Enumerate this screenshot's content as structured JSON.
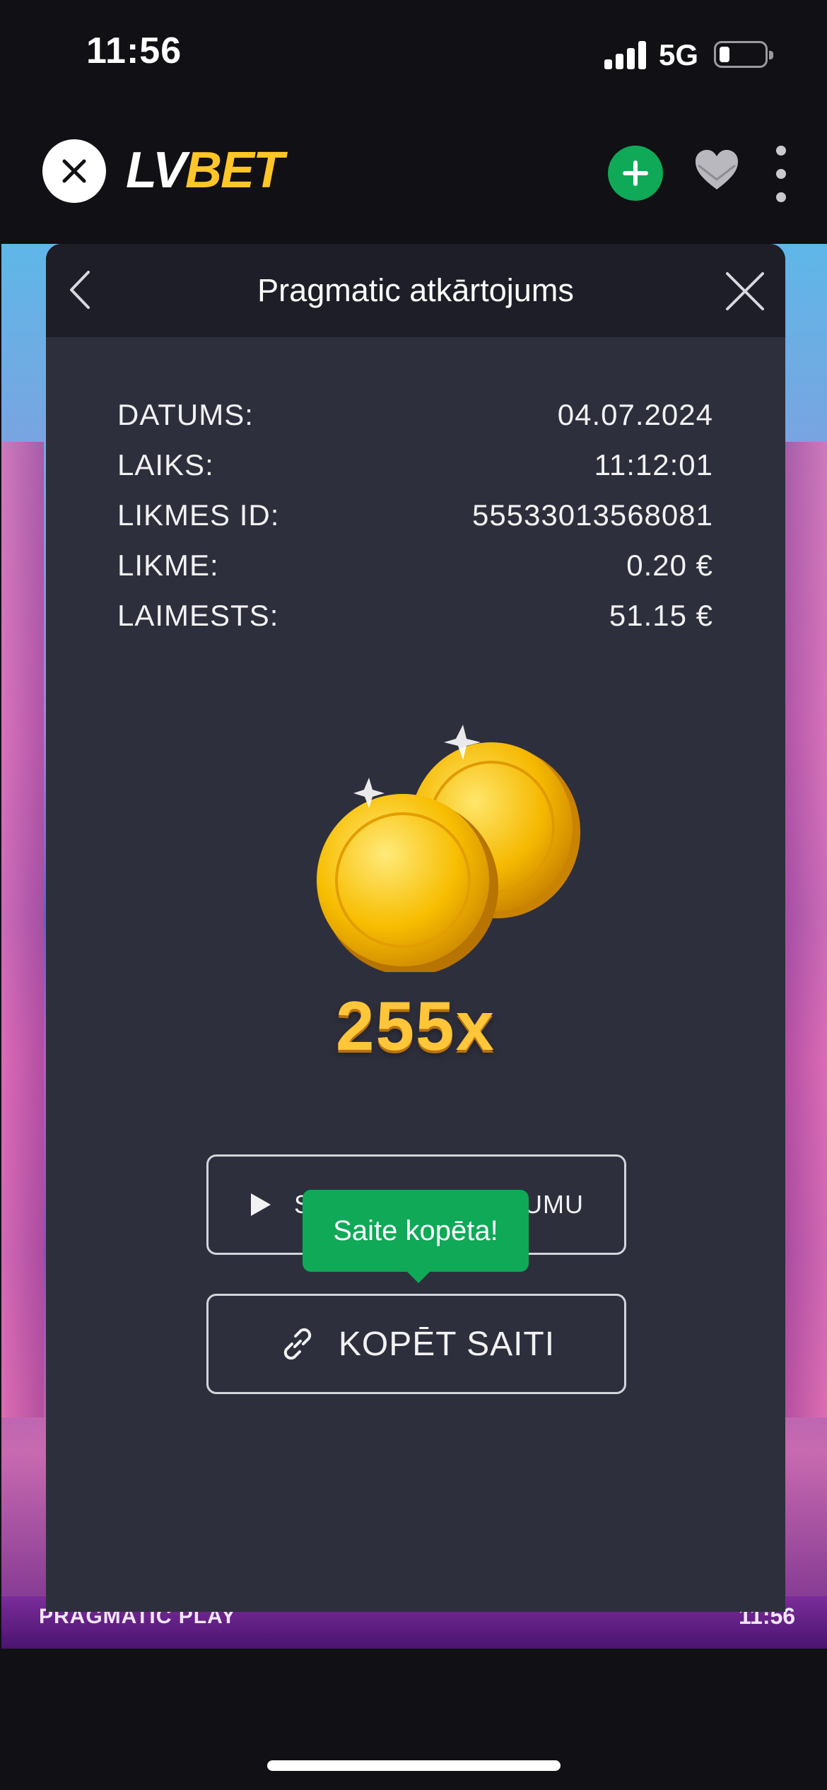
{
  "status_bar": {
    "time": "11:56",
    "network": "5G"
  },
  "app": {
    "brand_lv": "LV",
    "brand_bet": "BET",
    "brand_color": "#ffc629",
    "add_color": "#0fa958"
  },
  "game": {
    "provider": "PRAGMATIC PLAY",
    "clock": "11:56"
  },
  "modal": {
    "title": "Pragmatic atkārtojums",
    "rows": [
      {
        "label": "DATUMS:",
        "value": "04.07.2024"
      },
      {
        "label": "LAIKS:",
        "value": "11:12:01"
      },
      {
        "label": "LIKMES ID:",
        "value": "55533013568081"
      },
      {
        "label": "LIKME:",
        "value": "0.20 €"
      },
      {
        "label": "LAIMESTS:",
        "value": "51.15 €"
      }
    ],
    "multiplier": "255x",
    "watch_button": {
      "label_start": "S",
      "label_end": "UMU",
      "icon": "play-icon"
    },
    "copy_button": {
      "label": "KOPĒT SAITI",
      "icon": "link-icon"
    },
    "tooltip": "Saite kopēta!"
  }
}
